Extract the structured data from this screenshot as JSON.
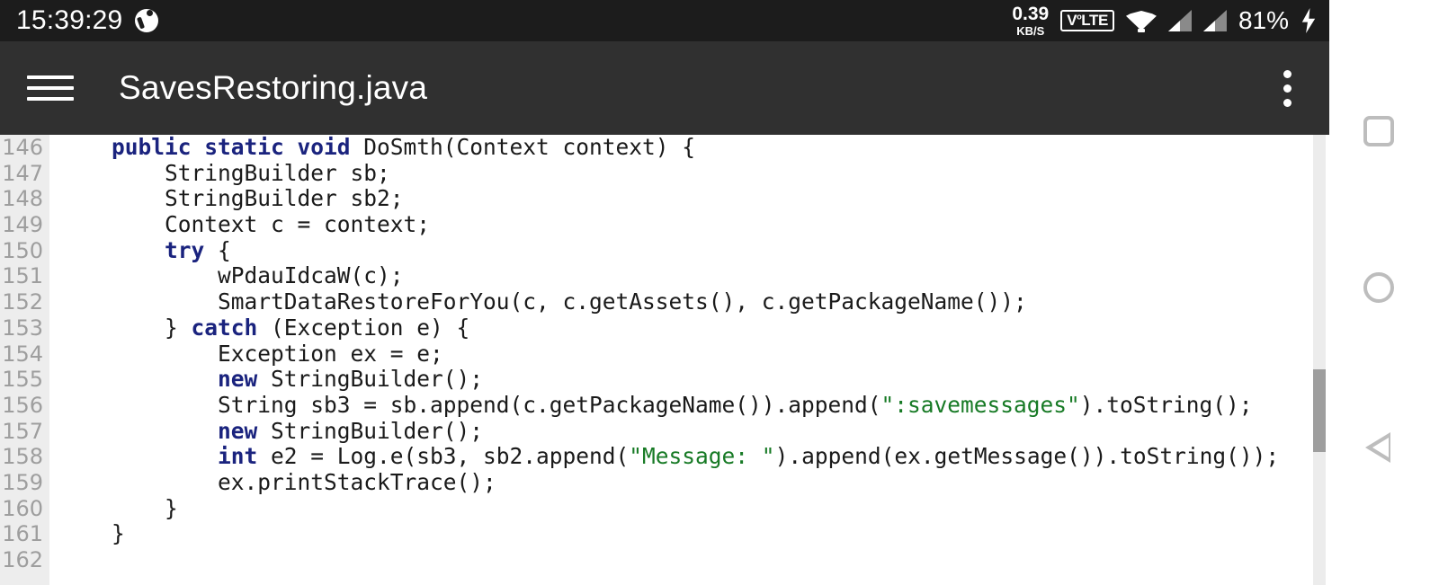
{
  "status_bar": {
    "clock": "15:39:29",
    "globe_icon": "globe-icon",
    "net_speed_value": "0.39",
    "net_speed_unit": "KB/S",
    "volte_label": "VoLTE",
    "wifi_icon": "wifi-icon",
    "signal_icon_1": "signal-bars-icon",
    "signal_icon_2": "signal-bars-icon",
    "battery_percent": "81%",
    "charging_icon": "lightning-bolt-icon",
    "background": "#1c1c1c"
  },
  "app_bar": {
    "menu_icon": "hamburger-menu-icon",
    "title": "SavesRestoring.java",
    "overflow_icon": "overflow-menu-icon",
    "background": "#303030"
  },
  "editor": {
    "gutter_background": "#ededed",
    "line_number_color": "#9e9e9e",
    "keyword_color": "#1a237e",
    "string_color": "#177a25",
    "text_color": "#1a1a1a",
    "line_numbers": [
      "146",
      "147",
      "148",
      "149",
      "150",
      "151",
      "152",
      "153",
      "154",
      "155",
      "156",
      "157",
      "158",
      "159",
      "160",
      "161",
      "162"
    ],
    "lines": [
      {
        "n": "146",
        "tokens": [
          {
            "t": "    ",
            "c": "plain"
          },
          {
            "t": "public static void",
            "c": "kw"
          },
          {
            "t": " DoSmth(Context context) {",
            "c": "plain"
          }
        ]
      },
      {
        "n": "147",
        "tokens": [
          {
            "t": "        StringBuilder sb;",
            "c": "plain"
          }
        ]
      },
      {
        "n": "148",
        "tokens": [
          {
            "t": "        StringBuilder sb2;",
            "c": "plain"
          }
        ]
      },
      {
        "n": "149",
        "tokens": [
          {
            "t": "        Context c = context;",
            "c": "plain"
          }
        ]
      },
      {
        "n": "150",
        "tokens": [
          {
            "t": "        ",
            "c": "plain"
          },
          {
            "t": "try",
            "c": "kw"
          },
          {
            "t": " {",
            "c": "plain"
          }
        ]
      },
      {
        "n": "151",
        "tokens": [
          {
            "t": "            wPdauIdcaW(c);",
            "c": "plain"
          }
        ]
      },
      {
        "n": "152",
        "tokens": [
          {
            "t": "            SmartDataRestoreForYou(c, c.getAssets(), c.getPackageName());",
            "c": "plain"
          }
        ]
      },
      {
        "n": "153",
        "tokens": [
          {
            "t": "        } ",
            "c": "plain"
          },
          {
            "t": "catch",
            "c": "kw"
          },
          {
            "t": " (Exception e) {",
            "c": "plain"
          }
        ]
      },
      {
        "n": "154",
        "tokens": [
          {
            "t": "            Exception ex = e;",
            "c": "plain"
          }
        ]
      },
      {
        "n": "155",
        "tokens": [
          {
            "t": "            ",
            "c": "plain"
          },
          {
            "t": "new",
            "c": "kw"
          },
          {
            "t": " StringBuilder();",
            "c": "plain"
          }
        ]
      },
      {
        "n": "156",
        "tokens": [
          {
            "t": "            String sb3 = sb.append(c.getPackageName()).append(",
            "c": "plain"
          },
          {
            "t": "\":savemessages\"",
            "c": "str"
          },
          {
            "t": ").toString();",
            "c": "plain"
          }
        ]
      },
      {
        "n": "157",
        "tokens": [
          {
            "t": "            ",
            "c": "plain"
          },
          {
            "t": "new",
            "c": "kw"
          },
          {
            "t": " StringBuilder();",
            "c": "plain"
          }
        ]
      },
      {
        "n": "158",
        "tokens": [
          {
            "t": "            ",
            "c": "plain"
          },
          {
            "t": "int",
            "c": "kw"
          },
          {
            "t": " e2 = Log.e(sb3, sb2.append(",
            "c": "plain"
          },
          {
            "t": "\"Message: \"",
            "c": "str"
          },
          {
            "t": ").append(ex.getMessage()).toString());",
            "c": "plain"
          }
        ]
      },
      {
        "n": "159",
        "tokens": [
          {
            "t": "            ex.printStackTrace();",
            "c": "plain"
          }
        ]
      },
      {
        "n": "160",
        "tokens": [
          {
            "t": "        }",
            "c": "plain"
          }
        ]
      },
      {
        "n": "161",
        "tokens": [
          {
            "t": "    }",
            "c": "plain"
          }
        ]
      },
      {
        "n": "162",
        "tokens": [
          {
            "t": "",
            "c": "plain"
          }
        ]
      }
    ],
    "scrollbar": {
      "track_color": "#ececec",
      "thumb_color": "#9e9e9e"
    }
  },
  "nav_bar": {
    "recents_icon": "square-recents-icon",
    "home_icon": "circle-home-icon",
    "back_icon": "triangle-back-icon",
    "background": "#ffffff"
  }
}
